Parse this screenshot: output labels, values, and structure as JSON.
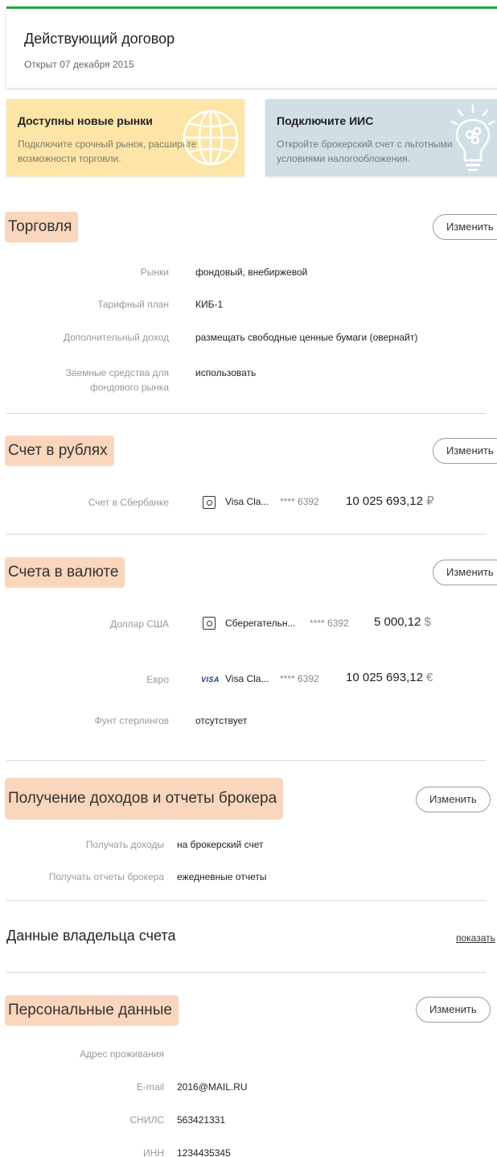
{
  "contract": {
    "title": "Действующий договор",
    "opened": "Открыт 07 декабря 2015"
  },
  "promos": [
    {
      "title": "Доступны новые рынки",
      "text": "Подключите срочный рынок, расширьте возможности торговли.",
      "icon": "globe-icon"
    },
    {
      "title": "Подключите ИИС",
      "text": "Откройте брокерский счет с льготными условиями налогообложения.",
      "icon": "lightbulb-icon"
    }
  ],
  "edit_label": "Изменить",
  "trading": {
    "title": "Торговля",
    "rows": [
      {
        "label": "Рынки",
        "value": "фондовый, внебиржевой"
      },
      {
        "label": "Тарифный план",
        "value": "КИБ-1"
      },
      {
        "label": "Дополнительный доход",
        "value": "размещать свободные ценные бумаги (овернайт)"
      },
      {
        "label_line1": "Заемные средства для",
        "label_line2": "фондового рынка",
        "value": "использовать"
      }
    ]
  },
  "rub_account": {
    "title": "Счет в рублях",
    "row": {
      "label": "Счет в Сбербанке",
      "icon": "safe-icon",
      "card": "Visa Cla...",
      "masked": "**** 6392",
      "amount": "10 025 693,12",
      "currency": "₽"
    }
  },
  "fx_accounts": {
    "title": "Счета в валюте",
    "rows": [
      {
        "label": "Доллар США",
        "icon": "safe-icon",
        "card": "Сберегательн...",
        "masked": "**** 6392",
        "amount": "5 000,12",
        "currency": "$"
      },
      {
        "label": "Евро",
        "icon": "visa-logo",
        "visa": "VISA",
        "card": "Visa Cla...",
        "masked": "**** 6392",
        "amount": "10 025 693,12",
        "currency": "€"
      },
      {
        "label": "Фунт стерлингов",
        "value": "отсутствует"
      }
    ]
  },
  "income": {
    "title": "Получение доходов и отчеты брокера",
    "rows": [
      {
        "label": "Получать доходы",
        "value": "на брокерский счет"
      },
      {
        "label": "Получать отчеты брокера",
        "value": "ежедневные отчеты"
      }
    ]
  },
  "owner": {
    "title": "Данные владельца счета",
    "show": "показать"
  },
  "personal": {
    "title": "Персональные данные",
    "rows": [
      {
        "label": "Адрес проживания",
        "value": ""
      },
      {
        "label": "E-mail",
        "value": "2016@MAIL.RU"
      },
      {
        "label": "СНИЛС",
        "value": "563421331"
      },
      {
        "label": "ИНН",
        "value": "1234435345"
      }
    ]
  }
}
